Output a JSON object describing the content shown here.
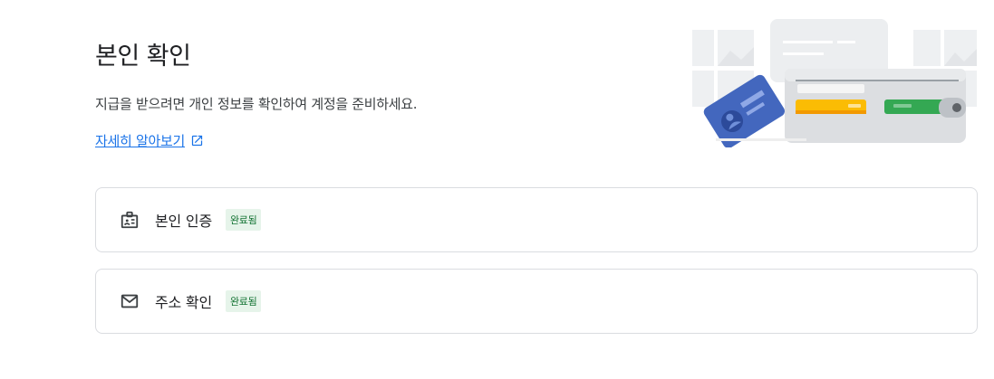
{
  "page": {
    "title": "본인 확인",
    "subtitle": "지급을 받으려면 개인 정보를 확인하여 계정을 준비하세요.",
    "learn_more": "자세히 알아보기"
  },
  "cards": [
    {
      "label": "본인 인증",
      "status": "완료됨",
      "icon": "id-badge-icon"
    },
    {
      "label": "주소 확인",
      "status": "완료됨",
      "icon": "mail-icon"
    }
  ],
  "colors": {
    "link": "#1a73e8",
    "badge_bg": "#e6f4ea",
    "badge_text": "#137333",
    "border": "#dadce0"
  }
}
